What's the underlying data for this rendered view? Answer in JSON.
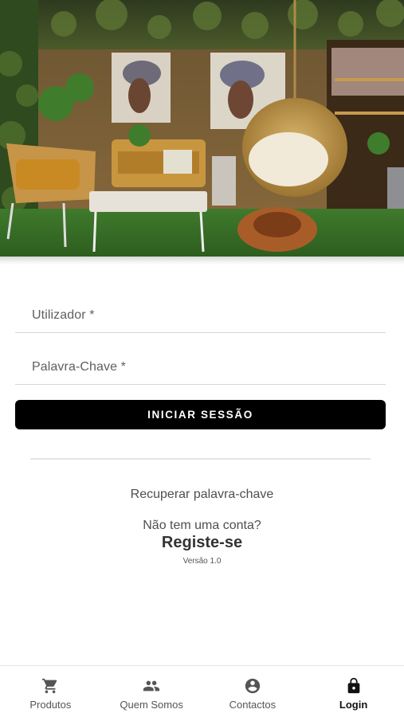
{
  "hero": {
    "image": "showroom-furniture-photo"
  },
  "form": {
    "username_label": "Utilizador *",
    "password_label": "Palavra-Chave *",
    "submit_label": "INICIAR SESSÃO"
  },
  "links": {
    "recover": "Recuperar palavra-chave",
    "no_account": "Não tem uma conta?",
    "register": "Registe-se",
    "version": "Versão 1.0"
  },
  "nav": {
    "items": [
      {
        "label": "Produtos",
        "icon": "cart-icon",
        "active": false
      },
      {
        "label": "Quem Somos",
        "icon": "people-icon",
        "active": false
      },
      {
        "label": "Contactos",
        "icon": "account-circle-icon",
        "active": false
      },
      {
        "label": "Login",
        "icon": "lock-icon",
        "active": true
      }
    ]
  },
  "colors": {
    "button_bg": "#000000",
    "button_text": "#ffffff",
    "divider": "#e4e4e4"
  }
}
